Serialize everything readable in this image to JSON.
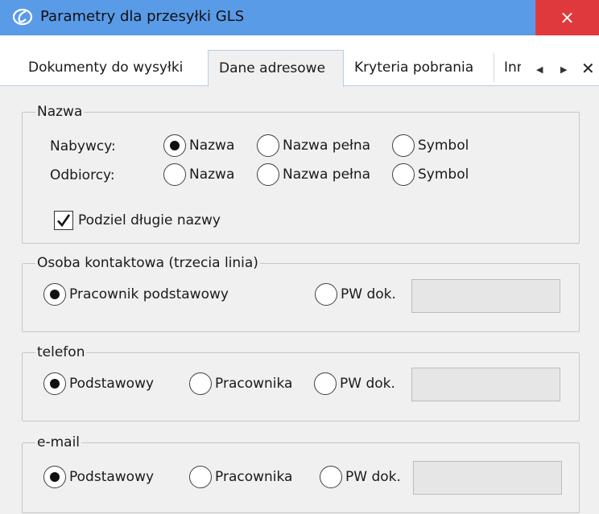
{
  "window": {
    "title": "Parametry dla przesyłki GLS",
    "close_glyph": "×",
    "icon": "app-logo-icon"
  },
  "tabs": [
    {
      "label": "Dokumenty do wysyłki",
      "active": false
    },
    {
      "label": "Dane adresowe",
      "active": true
    },
    {
      "label": "Kryteria pobrania",
      "active": false
    },
    {
      "label": "Inne",
      "active": false
    }
  ],
  "tab_controls": {
    "prev": "◀",
    "next": "▶",
    "close": "✕"
  },
  "nazwa": {
    "legend": "Nazwa",
    "rows": [
      {
        "label": "Nabywcy:",
        "options": [
          "Nazwa",
          "Nazwa pełna",
          "Symbol"
        ],
        "selected": 0
      },
      {
        "label": "Odbiorcy:",
        "options": [
          "Nazwa",
          "Nazwa pełna",
          "Symbol"
        ],
        "selected": -1
      }
    ],
    "checkbox": {
      "label": "Podziel długie nazwy",
      "checked": true
    }
  },
  "osoba": {
    "legend": "Osoba kontaktowa (trzecia linia)",
    "options": [
      "Pracownik podstawowy",
      "PW dok."
    ],
    "selected": 0,
    "pw_value": ""
  },
  "telefon": {
    "legend": "telefon",
    "options": [
      "Podstawowy",
      "Pracownika",
      "PW dok."
    ],
    "selected": 0,
    "pw_value": ""
  },
  "email": {
    "legend": "e-mail",
    "options": [
      "Podstawowy",
      "Pracownika",
      "PW dok."
    ],
    "selected": 0,
    "pw_value": ""
  },
  "colors": {
    "titlebar": "#5a9be8",
    "close": "#e0393d",
    "panel": "#f0f0f0"
  }
}
